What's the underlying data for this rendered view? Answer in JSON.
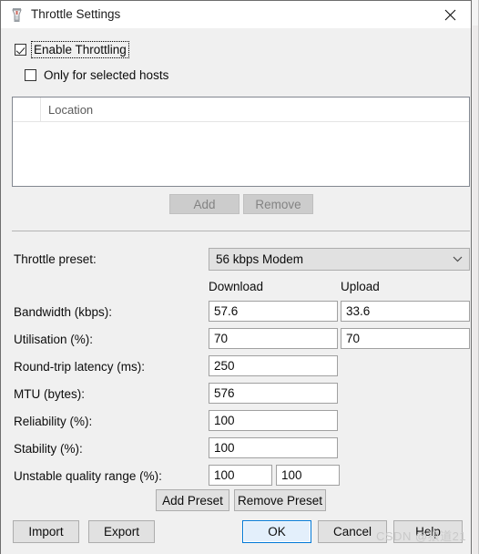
{
  "window": {
    "title": "Throttle Settings",
    "icon": "throttle-jar-icon",
    "close_label": "✕",
    "accent_color": "#0078d7",
    "background_color": "#f0f0f0"
  },
  "options": {
    "enable_throttling": {
      "label": "Enable Throttling",
      "checked": true,
      "focused": true
    },
    "only_selected_hosts": {
      "label": "Only for selected hosts",
      "checked": false
    }
  },
  "hosts_list": {
    "columns": [
      "",
      "Location"
    ],
    "rows": [],
    "buttons": {
      "add": "Add",
      "remove": "Remove"
    }
  },
  "preset": {
    "label": "Throttle preset:",
    "selected": "56 kbps Modem",
    "arrow_icon": "chevron-down-icon"
  },
  "columns": {
    "download": "Download",
    "upload": "Upload"
  },
  "fields": [
    {
      "key": "bandwidth",
      "label": "Bandwidth (kbps):",
      "download": "57.6",
      "upload": "33.6",
      "has_upload": true
    },
    {
      "key": "utilisation",
      "label": "Utilisation (%):",
      "download": "70",
      "upload": "70",
      "has_upload": true
    },
    {
      "key": "latency",
      "label": "Round-trip latency (ms):",
      "download": "250",
      "upload": "",
      "has_upload": false
    },
    {
      "key": "mtu",
      "label": "MTU (bytes):",
      "download": "576",
      "upload": "",
      "has_upload": false
    },
    {
      "key": "reliability",
      "label": "Reliability (%):",
      "download": "100",
      "upload": "",
      "has_upload": false
    },
    {
      "key": "stability",
      "label": "Stability (%):",
      "download": "100",
      "upload": "",
      "has_upload": false
    }
  ],
  "unstable_range": {
    "label": "Unstable quality range (%):",
    "min": "100",
    "max": "100"
  },
  "preset_buttons": {
    "add_preset": "Add Preset",
    "remove_preset": "Remove Preset"
  },
  "dialog_buttons": {
    "import": "Import",
    "export": "Export",
    "ok": "OK",
    "cancel": "Cancel",
    "help": "Help"
  },
  "watermark": "CSDN @狼道21"
}
